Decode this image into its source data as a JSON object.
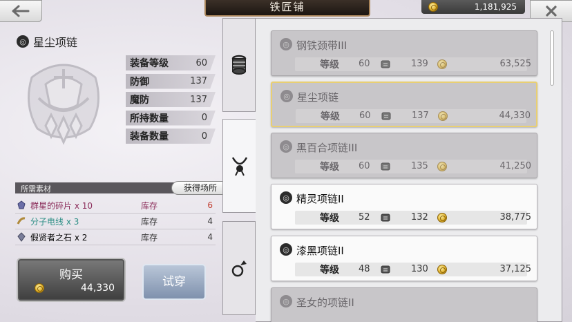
{
  "window": {
    "title": "铁匠铺"
  },
  "currency": {
    "gold": "1,181,925",
    "icon": "gold-coin-icon"
  },
  "colors": {
    "accent_gold": "#e9cf72",
    "stock_red": "#c0392b",
    "material_teal": "#2e8f86",
    "material_purple": "#8b2c5a"
  },
  "selected_item": {
    "name": "星尘项链",
    "stats": [
      {
        "label": "装备等级",
        "value": "60"
      },
      {
        "label": "防御",
        "value": "137"
      },
      {
        "label": "魔防",
        "value": "137"
      },
      {
        "label": "所持数量",
        "value": "0"
      },
      {
        "label": "装备数量",
        "value": "0"
      }
    ]
  },
  "materials": {
    "header": "所需素材",
    "source_button": "获得场所",
    "items": [
      {
        "name": "群星的碎片 x 10",
        "stock_label": "库存",
        "count": "6",
        "color": "#8b2c5a",
        "count_color": "#c0392b"
      },
      {
        "name": "分子电线 x 3",
        "stock_label": "库存",
        "count": "4",
        "color": "#2e8f86",
        "count_color": "#333333"
      },
      {
        "name": "假贤者之石 x 2",
        "stock_label": "库存",
        "count": "4",
        "color": "#333333",
        "count_color": "#333333"
      }
    ]
  },
  "buy_button": {
    "label": "购买",
    "price": "44,330"
  },
  "try_button": {
    "label": "试穿"
  },
  "tabs": [
    {
      "name": "armband",
      "icon": "armband-icon"
    },
    {
      "name": "necklace",
      "icon": "necklace-icon",
      "active": true
    },
    {
      "name": "ring",
      "icon": "ring-icon"
    }
  ],
  "list_labels": {
    "level": "等级"
  },
  "list": [
    {
      "name": "钢铁颈带III",
      "level": "60",
      "defense": "139",
      "price": "63,525",
      "state": "dim"
    },
    {
      "name": "星尘项链",
      "level": "60",
      "defense": "137",
      "price": "44,330",
      "state": "selected"
    },
    {
      "name": "黑百合项链III",
      "level": "60",
      "defense": "135",
      "price": "41,250",
      "state": "dim"
    },
    {
      "name": "精灵项链II",
      "level": "52",
      "defense": "132",
      "price": "38,775",
      "state": "normal"
    },
    {
      "name": "漆黑项链II",
      "level": "48",
      "defense": "130",
      "price": "37,125",
      "state": "normal"
    },
    {
      "name": "圣女的项链II",
      "level": "",
      "defense": "",
      "price": "",
      "state": "dim"
    }
  ]
}
